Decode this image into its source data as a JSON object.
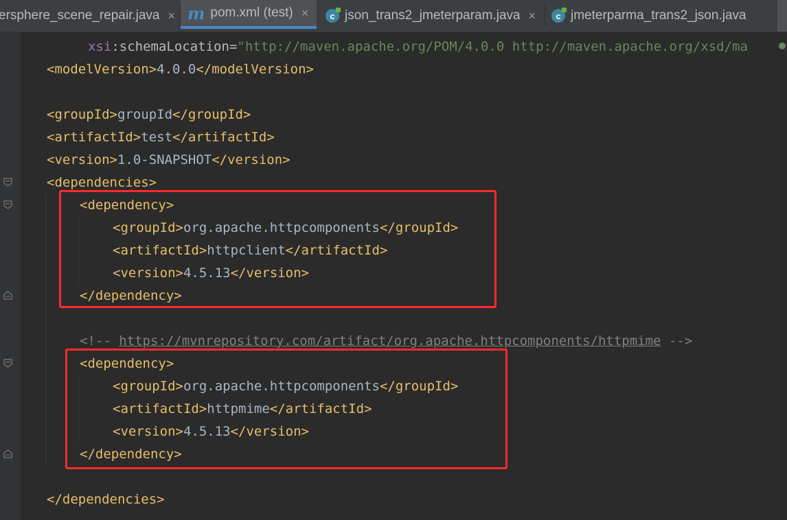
{
  "tabs": [
    {
      "label": "ersphere_scene_repair.java",
      "icon": "java-class-icon",
      "active": false
    },
    {
      "label": "pom.xml (test)",
      "icon": "maven-icon",
      "active": true
    },
    {
      "label": "json_trans2_jmeterparam.java",
      "icon": "java-class-icon",
      "active": false
    },
    {
      "label": "jmeterparma_trans2_json.java",
      "icon": "java-class-icon",
      "active": false
    }
  ],
  "icons": {
    "maven": "m",
    "java_class": "c",
    "close": "×"
  },
  "code": {
    "l1_ns": "xsi",
    "l1_colon": ":",
    "l1_attr": "schemaLocation",
    "l1_eq": "=",
    "l1_value": "\"http://maven.apache.org/POM/4.0.0 http://maven.apache.org/xsd/ma",
    "l2_open": "<modelVersion>",
    "l2_text": "4.0.0",
    "l2_close": "</modelVersion>",
    "l4_open": "<groupId>",
    "l4_text": "groupId",
    "l4_close": "</groupId>",
    "l5_open": "<artifactId>",
    "l5_text": "test",
    "l5_close": "</artifactId>",
    "l6_open": "<version>",
    "l6_text": "1.0-SNAPSHOT",
    "l6_close": "</version>",
    "l7_open": "<dependencies>",
    "dep1_open": "<dependency>",
    "dep1_group_open": "<groupId>",
    "dep1_group_text": "org.apache.httpcomponents",
    "dep1_group_close": "</groupId>",
    "dep1_artifact_open": "<artifactId>",
    "dep1_artifact_text": "httpclient",
    "dep1_artifact_close": "</artifactId>",
    "dep1_version_open": "<version>",
    "dep1_version_text": "4.5.13",
    "dep1_version_close": "</version>",
    "dep1_close": "</dependency>",
    "comment_start": "<!-- ",
    "comment_url": "https://mvnrepository.com/artifact/org.apache.httpcomponents/httpmime",
    "comment_end": " -->",
    "dep2_open": "<dependency>",
    "dep2_group_open": "<groupId>",
    "dep2_group_text": "org.apache.httpcomponents",
    "dep2_group_close": "</groupId>",
    "dep2_artifact_open": "<artifactId>",
    "dep2_artifact_text": "httpmime",
    "dep2_artifact_close": "</artifactId>",
    "dep2_version_open": "<version>",
    "dep2_version_text": "4.5.13",
    "dep2_version_close": "</version>",
    "dep2_close": "</dependency>",
    "deps_close": "</dependencies>"
  },
  "colors": {
    "background": "#2b2b2b",
    "tag": "#e8bf6a",
    "text": "#a9b7c6",
    "string": "#6a8759",
    "comment": "#808080",
    "highlight_box": "#ff2b2b",
    "active_tab_underline": "#4a88c7"
  }
}
